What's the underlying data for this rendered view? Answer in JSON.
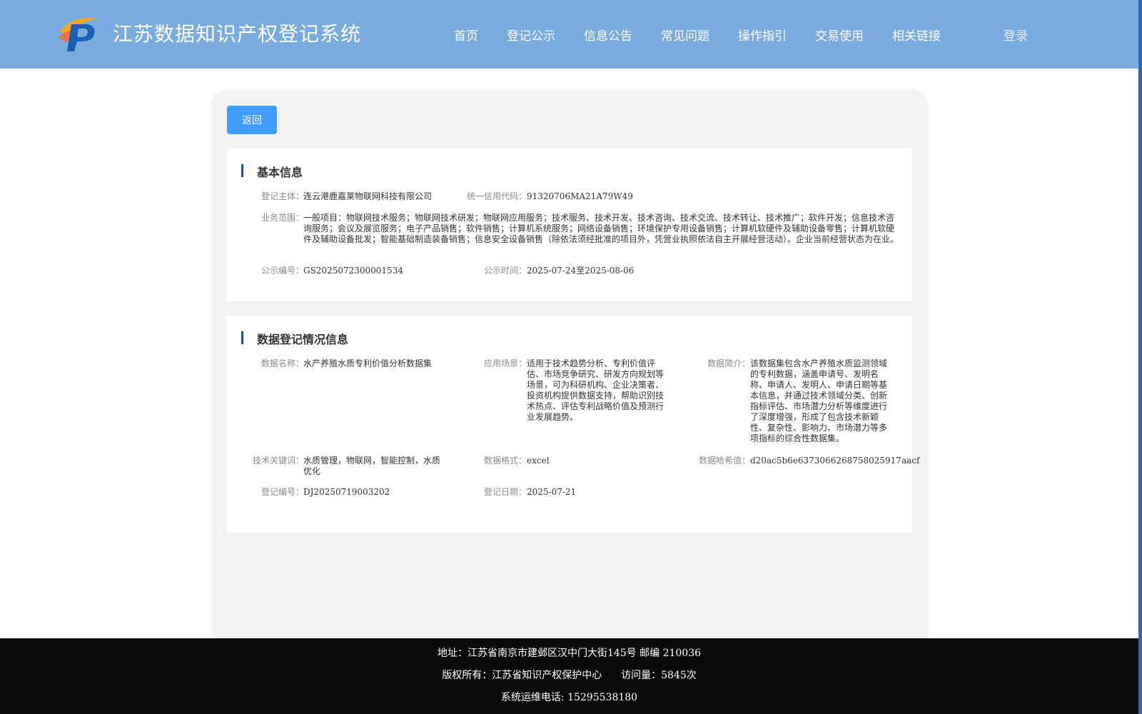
{
  "header": {
    "title": "江苏数据知识产权登记系统",
    "nav": [
      "首页",
      "登记公示",
      "信息公告",
      "常见问题",
      "操作指引",
      "交易使用",
      "相关链接"
    ],
    "login": "登录"
  },
  "back_label": "返回",
  "basic": {
    "title": "基本信息",
    "subject_label": "登记主体：",
    "subject": "连云港鹿嘉莱物联网科技有限公司",
    "credit_label": "统一信用代码：",
    "credit": "91320706MA21A79W49",
    "scope_label": "业务范围：",
    "scope": "一般项目：物联网技术服务；物联网技术研发；物联网应用服务；技术服务、技术开发、技术咨询、技术交流、技术转让、技术推广；软件开发；信息技术咨询服务；会议及展览服务；电子产品销售；软件销售；计算机系统服务；网络设备销售；环境保护专用设备销售；计算机软硬件及辅助设备零售；计算机软硬件及辅助设备批发；智能基础制造装备销售；信息安全设备销售（除依法须经批准的项目外，凭营业执照依法自主开展经营活动）。企业当前经营状态为在业。",
    "pub_no_label": "公示编号：",
    "pub_no": "GS2025072300001534",
    "pub_time_label": "公示时间：",
    "pub_time": "2025-07-24至2025-08-06"
  },
  "data_reg": {
    "title": "数据登记情况信息",
    "name_label": "数据名称：",
    "name": "水产养殖水质专利价值分析数据集",
    "scene_label": "应用场景：",
    "scene": "适用于技术趋势分析、专利价值评估、市场竞争研究、研发方向规划等场景，可为科研机构、企业决策者、投资机构提供数据支持，帮助识别技术热点、评估专利战略价值及预测行业发展趋势。",
    "intro_label": "数据简介：",
    "intro": "该数据集包含水产养殖水质监测领域的专利数据，涵盖申请号、发明名称、申请人、发明人、申请日期等基本信息，并通过技术领域分类、创新指标评估、市场潜力分析等维度进行了深度增强，形成了包含技术新颖性、复杂性、影响力、市场潜力等多项指标的综合性数据集。",
    "keywords_label": "技术关键词：",
    "keywords": "水质管理，物联网，智能控制，水质优化",
    "format_label": "数据格式：",
    "format": "excel",
    "hash_label": "数据哈希值：",
    "hash": "d20ac5b6e6373066268758025917aacf",
    "reg_no_label": "登记编号：",
    "reg_no": "DJ20250719003202",
    "reg_date_label": "登记日期：",
    "reg_date": "2025-07-21"
  },
  "footer": {
    "address": "地址：江苏省南京市建邺区汉中门大街145号 邮编 210036",
    "copyright": "版权所有：江苏省知识产权保护中心",
    "visits": "访问量：5845次",
    "phone": "系统运维电话: 15295538180"
  }
}
